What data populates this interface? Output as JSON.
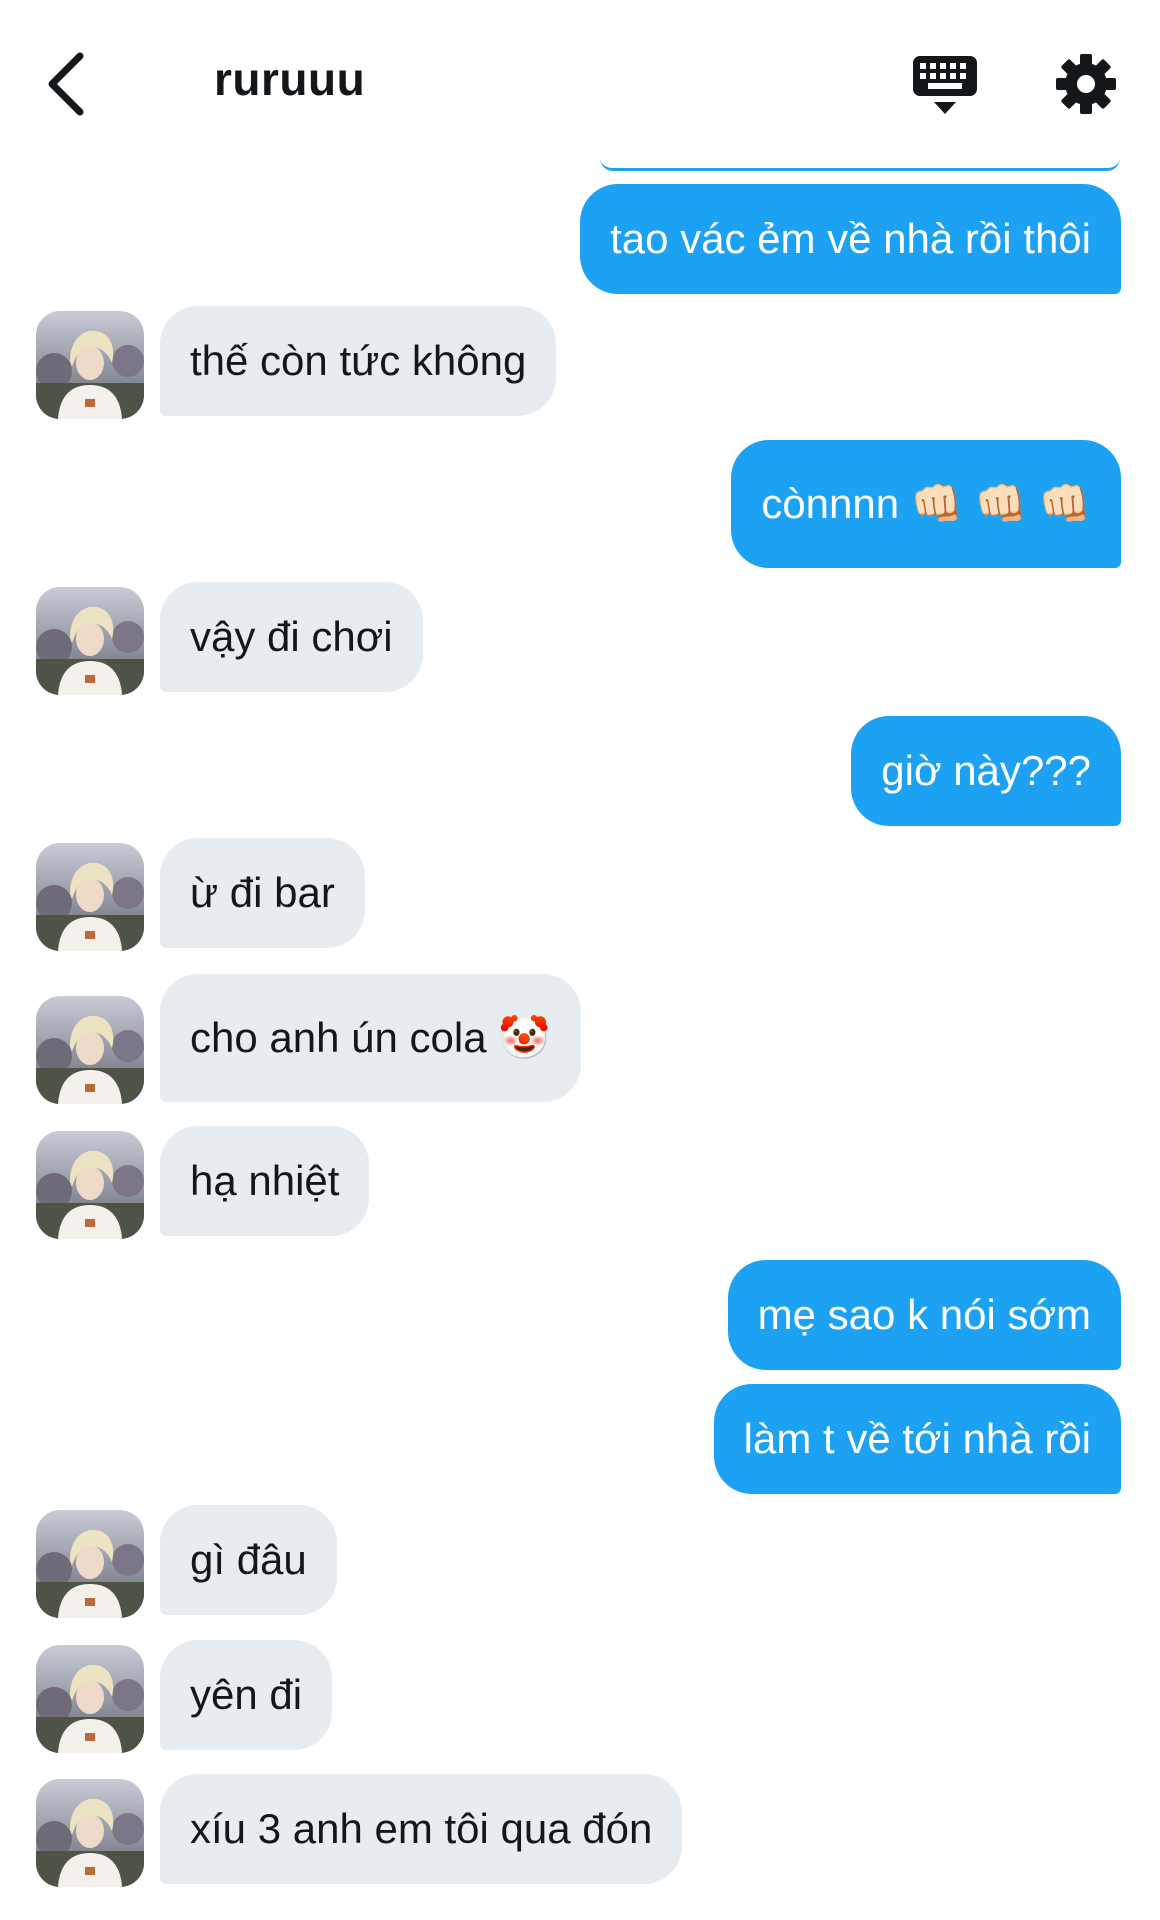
{
  "header": {
    "title": "ruruuu",
    "back_icon": "chevron-left-icon",
    "keyboard_icon": "keyboard-icon",
    "settings_icon": "gear-icon"
  },
  "colors": {
    "outgoing_bubble": "#1da1f2",
    "incoming_bubble": "#e6ecf0",
    "text": "#14171a"
  },
  "messages": [
    {
      "side": "out",
      "text": "tao vác ẻm về nhà rồi thôi"
    },
    {
      "side": "in",
      "text": "thế còn tức không"
    },
    {
      "side": "out",
      "text": "cònnnn 👊🏻 👊🏻 👊🏻"
    },
    {
      "side": "in",
      "text": "vậy đi chơi"
    },
    {
      "side": "out",
      "text": "giờ này???"
    },
    {
      "side": "in",
      "text": "ừ đi bar"
    },
    {
      "side": "in",
      "text": "cho anh ún cola 🤡"
    },
    {
      "side": "in",
      "text": "hạ nhiệt"
    },
    {
      "side": "out",
      "text": "mẹ sao k nói sớm"
    },
    {
      "side": "out",
      "text": "làm t về tới nhà rồi"
    },
    {
      "side": "in",
      "text": "gì đâu"
    },
    {
      "side": "in",
      "text": "yên đi"
    },
    {
      "side": "in",
      "text": "xíu 3 anh em tôi qua đón"
    }
  ]
}
